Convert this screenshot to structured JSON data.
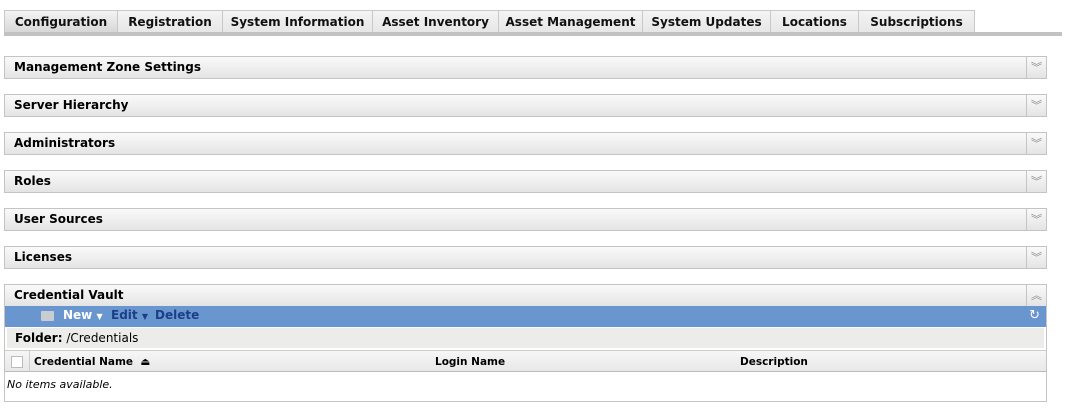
{
  "tabs": [
    {
      "label": "Configuration",
      "active": true
    },
    {
      "label": "Registration"
    },
    {
      "label": "System Information"
    },
    {
      "label": "Asset Inventory"
    },
    {
      "label": "Asset Management"
    },
    {
      "label": "System Updates"
    },
    {
      "label": "Locations"
    },
    {
      "label": "Subscriptions"
    }
  ],
  "panels": [
    {
      "title": "Management Zone Settings",
      "icon": "expand-icon"
    },
    {
      "title": "Server Hierarchy",
      "icon": "expand-icon"
    },
    {
      "title": "Administrators",
      "icon": "expand-icon"
    },
    {
      "title": "Roles",
      "icon": "expand-icon"
    },
    {
      "title": "User Sources",
      "icon": "expand-icon"
    },
    {
      "title": "Licenses",
      "icon": "expand-icon"
    },
    {
      "title": "Credential Vault",
      "icon": "collapse-icon"
    }
  ],
  "vault": {
    "toolbar": {
      "new": "New",
      "edit": "Edit",
      "delete": "Delete"
    },
    "folder_label": "Folder:",
    "folder_path": "/Credentials",
    "columns": [
      "Credential Name",
      "Login Name",
      "Description"
    ],
    "empty": "No items available."
  },
  "colors": {
    "toolbar": "#6a96d0",
    "link": "#1d3e86"
  }
}
